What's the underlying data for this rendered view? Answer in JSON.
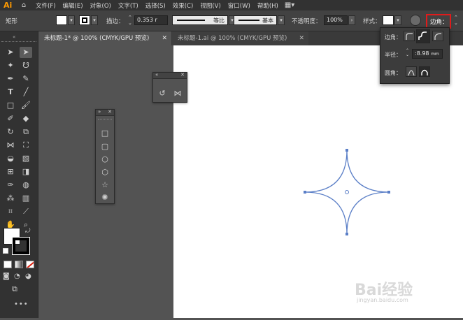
{
  "app": {
    "logo": "Ai"
  },
  "menu": [
    "文件(F)",
    "编辑(E)",
    "对象(O)",
    "文字(T)",
    "选择(S)",
    "效果(C)",
    "视图(V)",
    "窗口(W)",
    "帮助(H)"
  ],
  "control_bar": {
    "object_type": "矩形",
    "stroke_label": "描边：",
    "stroke_value": "0.353 r",
    "profile_label": "等比",
    "brush_label": "基本",
    "opacity_label": "不透明度：",
    "opacity_value": "100%",
    "style_label": "样式：",
    "corners_label": "边角："
  },
  "tabs": [
    {
      "label": "未标题-1* @ 100% (CMYK/GPU 预览)",
      "active": true
    },
    {
      "label": "未标题-1.ai @ 100% (CMYK/GPU 预览)",
      "active": false
    }
  ],
  "corner_popup": {
    "corner_label": "边角：",
    "radius_label": "半径：",
    "radius_value": ":8.98",
    "radius_unit": "mm",
    "rounding_label": "圆角："
  },
  "watermark": {
    "logo": "Bai经验",
    "url": "jingyan.baidu.com"
  },
  "colors": {
    "shape_stroke": "#5b7fc7",
    "highlight": "#e01b1b",
    "ui_dark": "#323232",
    "canvas": "#ffffff"
  }
}
